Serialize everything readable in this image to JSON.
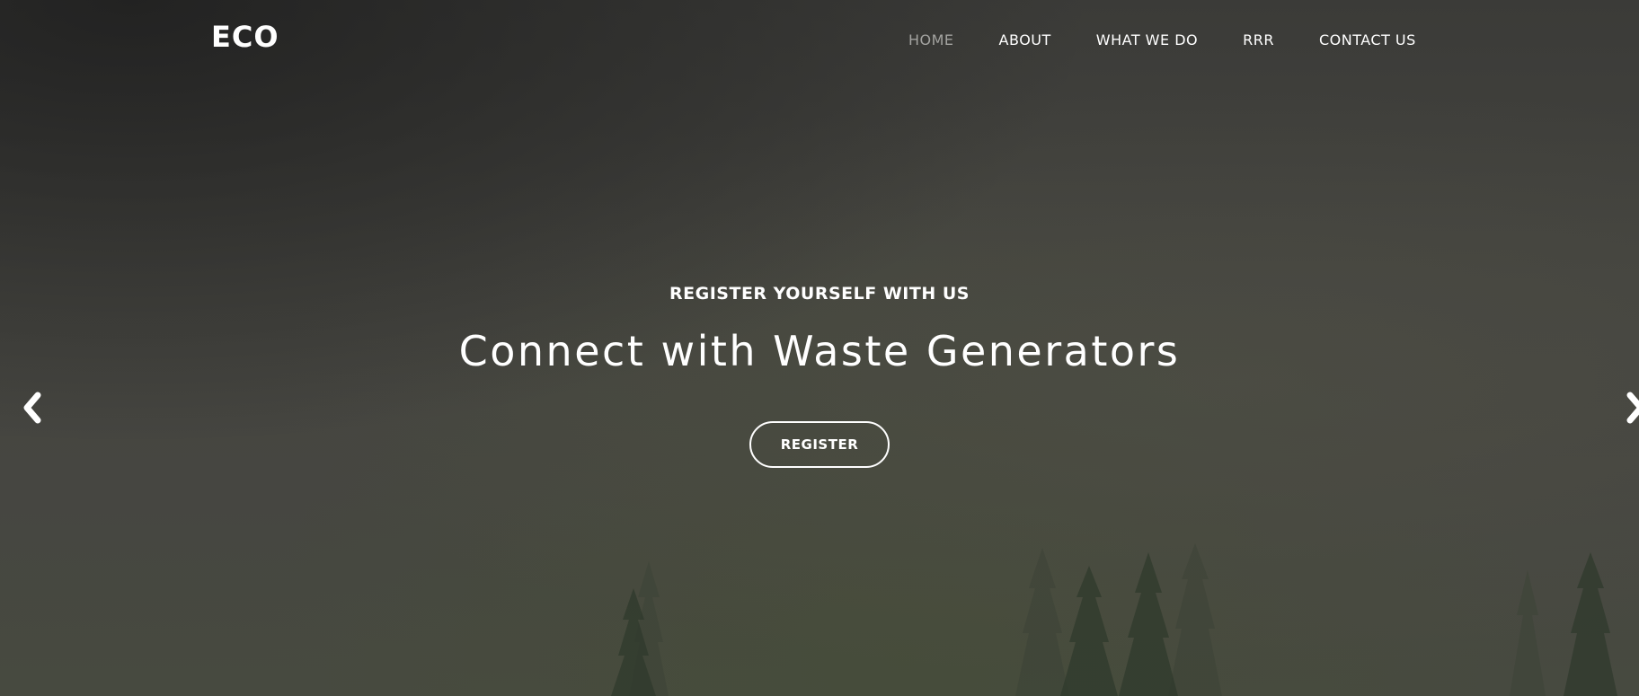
{
  "brand": {
    "logo_text": "ECO"
  },
  "nav": {
    "items": [
      {
        "label": "HOME",
        "active": true
      },
      {
        "label": "ABOUT",
        "active": false
      },
      {
        "label": "WHAT WE DO",
        "active": false
      },
      {
        "label": "RRR",
        "active": false
      },
      {
        "label": "CONTACT US",
        "active": false
      }
    ]
  },
  "hero": {
    "eyebrow": "REGISTER YOURSELF WITH US",
    "headline": "Connect with Waste Generators",
    "cta_label": "REGISTER"
  },
  "carousel": {
    "prev_icon": "chevron-left-icon",
    "next_icon": "chevron-right-icon"
  },
  "colors": {
    "text": "#ffffff",
    "nav_active": "#a3a3a0",
    "overlay": "#3a3a36"
  }
}
